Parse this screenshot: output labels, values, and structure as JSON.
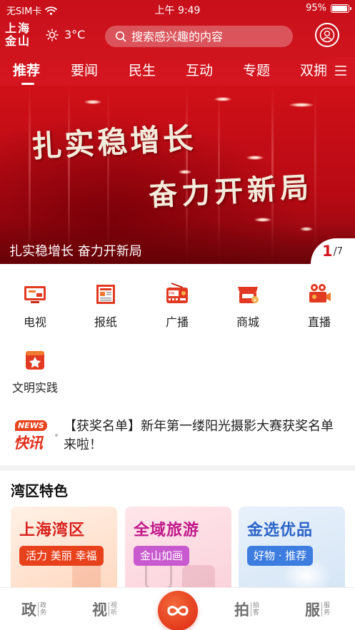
{
  "status_bar": {
    "carrier": "无SIM卡",
    "time": "上午 9:49",
    "battery": "95%",
    "battery_level": 0.95
  },
  "header": {
    "logo_line1": "上海",
    "logo_line2": "金山",
    "temperature": "3°C",
    "weather_icon": "sun-icon",
    "search_placeholder": "搜索感兴趣的内容",
    "avatar_icon": "user-avatar-icon"
  },
  "tabs": [
    {
      "label": "推荐",
      "active": true
    },
    {
      "label": "要闻"
    },
    {
      "label": "民生"
    },
    {
      "label": "互动"
    },
    {
      "label": "专题"
    },
    {
      "label": "双拥"
    }
  ],
  "banner": {
    "headline_1": "扎实稳增长",
    "headline_2": "奋力开新局",
    "caption": "扎实稳增长 奋力开新局",
    "current_page": "1",
    "total_pages": "7"
  },
  "quick_links": [
    {
      "label": "电视",
      "icon": "tv-icon"
    },
    {
      "label": "报纸",
      "icon": "newspaper-icon"
    },
    {
      "label": "广播",
      "icon": "radio-icon"
    },
    {
      "label": "商城",
      "icon": "shop-icon"
    },
    {
      "label": "直播",
      "icon": "live-camera-icon"
    },
    {
      "label": "文明实践",
      "icon": "star-badge-icon"
    }
  ],
  "news": {
    "badge_en": "NEWS",
    "badge_zh": "快讯",
    "headline": "【获奖名单】新年第一缕阳光摄影大赛获奖名单来啦！"
  },
  "section": {
    "title": "湾区特色",
    "cards": [
      {
        "title": "上海湾区",
        "tag": "活力 美丽 幸福",
        "title_color": "#d8201c",
        "tag_color": "#e8421c"
      },
      {
        "title": "全域旅游",
        "tag": "金山如画",
        "title_color": "#c0188a",
        "tag_color": "#c85ad0"
      },
      {
        "title": "金选优品",
        "tag": "好物 · 推荐",
        "title_color": "#2b64c8",
        "tag_color": "#3e7de0"
      }
    ]
  },
  "tabbar": [
    {
      "big": "政",
      "small_1": "政",
      "small_2": "务"
    },
    {
      "big": "视",
      "small_1": "视",
      "small_2": "听"
    },
    {
      "center_icon": "infinity-logo-icon"
    },
    {
      "big": "拍",
      "small_1": "拍",
      "small_2": "客"
    },
    {
      "big": "服",
      "small_1": "服",
      "small_2": "务"
    }
  ],
  "colors": {
    "brand_red": "#d41620",
    "active_text": "#d41620"
  }
}
